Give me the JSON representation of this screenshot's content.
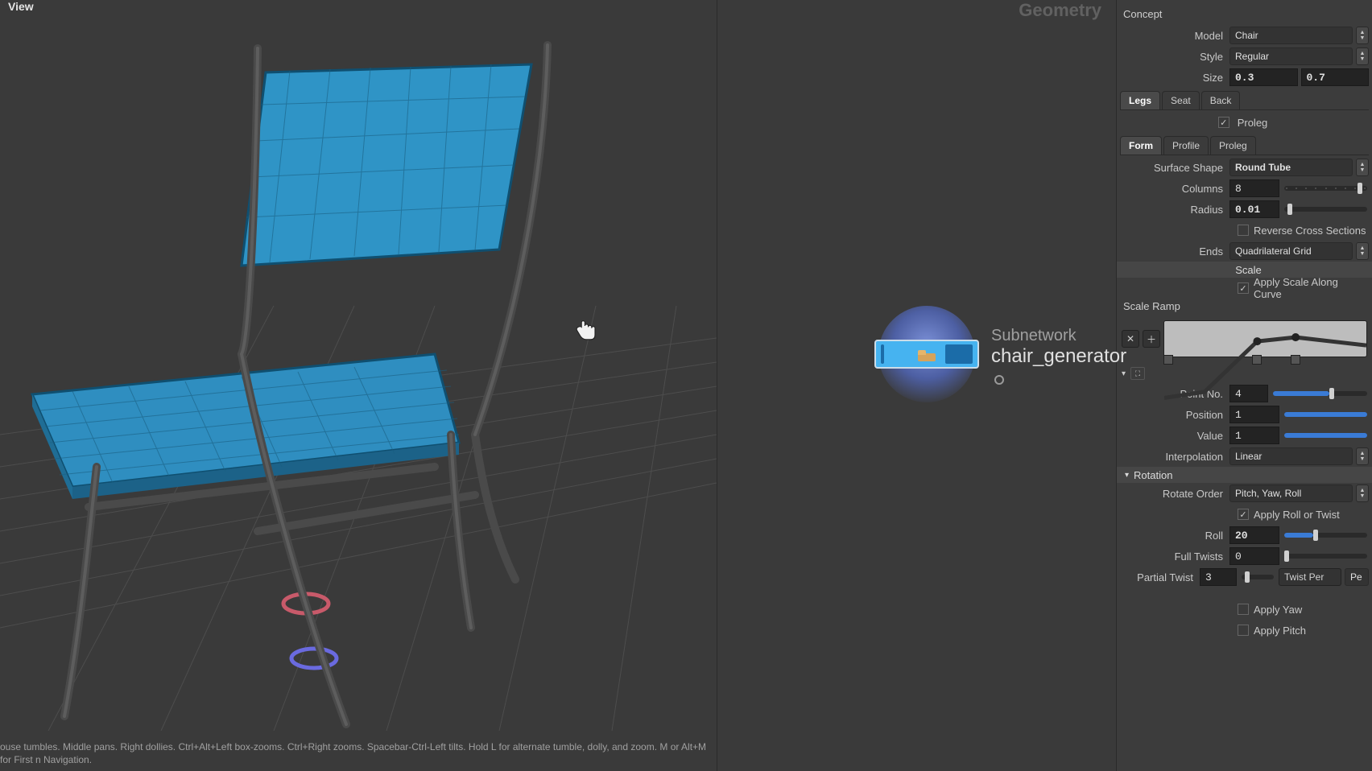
{
  "viewport": {
    "title": "View",
    "help_text": "ouse tumbles. Middle pans. Right dollies. Ctrl+Alt+Left box-zooms. Ctrl+Right zooms. Spacebar-Ctrl-Left tilts. Hold L for alternate tumble, dolly, and zoom. M or Alt+M for First n Navigation."
  },
  "network": {
    "context_label": "Geometry",
    "node": {
      "type_label": "Subnetwork",
      "name": "chair_generator"
    }
  },
  "params": {
    "concept_header": "Concept",
    "model": {
      "label": "Model",
      "value": "Chair"
    },
    "style": {
      "label": "Style",
      "value": "Regular"
    },
    "size": {
      "label": "Size",
      "a": "0.3",
      "b": "0.7"
    },
    "part_tabs": {
      "legs": "Legs",
      "seat": "Seat",
      "back": "Back",
      "active": "legs"
    },
    "proleg_check": {
      "label": "Proleg",
      "checked": true
    },
    "fpp_tabs": {
      "form": "Form",
      "profile": "Profile",
      "proleg": "Proleg",
      "active": "form"
    },
    "surface_shape": {
      "label": "Surface Shape",
      "value": "Round Tube"
    },
    "columns": {
      "label": "Columns",
      "value": "8",
      "fill_pct": 88
    },
    "radius": {
      "label": "Radius",
      "value": "0.01",
      "fill_pct": 4
    },
    "reverse_cross": {
      "label": "Reverse Cross Sections",
      "checked": false
    },
    "ends": {
      "label": "Ends",
      "value": "Quadrilateral Grid"
    },
    "scale_header": "Scale",
    "apply_scale": {
      "label": "Apply Scale Along Curve",
      "checked": true
    },
    "scale_ramp_label": "Scale Ramp",
    "ramp_ctrl_positions_pct": [
      2,
      46,
      65
    ],
    "point_no": {
      "label": "Point No.",
      "value": "4",
      "fill_pct": 60
    },
    "position": {
      "label": "Position",
      "value": "1",
      "fill_pct": 100
    },
    "value": {
      "label": "Value",
      "value": "1",
      "fill_pct": 100
    },
    "interpolation": {
      "label": "Interpolation",
      "value": "Linear"
    },
    "rotation_header": "Rotation",
    "rotate_order": {
      "label": "Rotate Order",
      "value": "Pitch, Yaw, Roll"
    },
    "apply_roll": {
      "label": "Apply Roll or Twist",
      "checked": true
    },
    "roll": {
      "label": "Roll",
      "value": "20",
      "fill_pct": 35
    },
    "full_twists": {
      "label": "Full Twists",
      "value": "0",
      "fill_pct": 0
    },
    "partial_twist": {
      "label": "Partial Twist",
      "value": "3",
      "fill_pct": 10,
      "per_label": "Twist Per",
      "per_value": "Pe"
    },
    "apply_yaw": {
      "label": "Apply Yaw",
      "checked": false
    },
    "apply_pitch": {
      "label": "Apply Pitch",
      "checked": false
    }
  }
}
